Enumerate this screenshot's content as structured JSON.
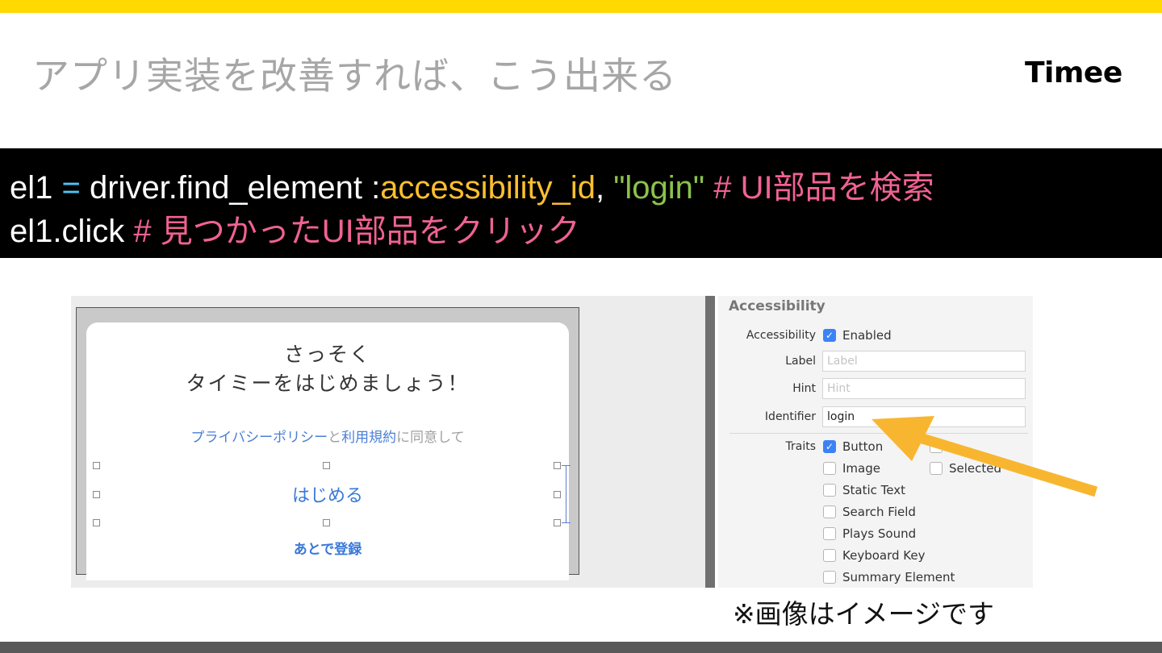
{
  "slide": {
    "title": "アプリ実装を改善すれば、こう出来る",
    "logo": "Timee",
    "footnote": "※画像はイメージです"
  },
  "code": {
    "line1": {
      "var": "el1",
      "op": " = ",
      "call": "driver.find_element :",
      "symbol": "accessibility_id",
      "comma": ", ",
      "string": "\"login\"",
      "comment": " # UI部品を検索"
    },
    "line2": {
      "call": "el1.click",
      "comment": " # 見つかったUI部品をクリック"
    }
  },
  "app_preview": {
    "heading_line1": "さっそく",
    "heading_line2": "タイミーをはじめましょう！",
    "privacy_link": "プライバシーポリシー",
    "and": "と",
    "terms_link": "利用規約",
    "agree": "に同意して",
    "start_button": "はじめる",
    "later_button": "あとで登録"
  },
  "inspector": {
    "section_title": "Accessibility",
    "accessibility_label": "Accessibility",
    "enabled_label": "Enabled",
    "enabled_checked": true,
    "label_label": "Label",
    "label_placeholder": "Label",
    "hint_label": "Hint",
    "hint_placeholder": "Hint",
    "identifier_label": "Identifier",
    "identifier_value": "login",
    "traits_label": "Traits",
    "traits": [
      {
        "label": "Button",
        "checked": true
      },
      {
        "label": "Image",
        "checked": false
      },
      {
        "label": "Static Text",
        "checked": false
      },
      {
        "label": "Search Field",
        "checked": false
      },
      {
        "label": "Plays Sound",
        "checked": false
      },
      {
        "label": "Keyboard Key",
        "checked": false
      },
      {
        "label": "Summary Element",
        "checked": false
      }
    ],
    "traits_right": [
      {
        "label": "",
        "checked": false
      },
      {
        "label": "Selected",
        "checked": false
      }
    ]
  },
  "colors": {
    "accent_yellow": "#FFD900",
    "arrow": "#F8B630",
    "code_operator": "#4FC3F7",
    "code_symbol": "#FBBF2E",
    "code_string": "#8BC34A",
    "code_comment": "#F06292"
  }
}
